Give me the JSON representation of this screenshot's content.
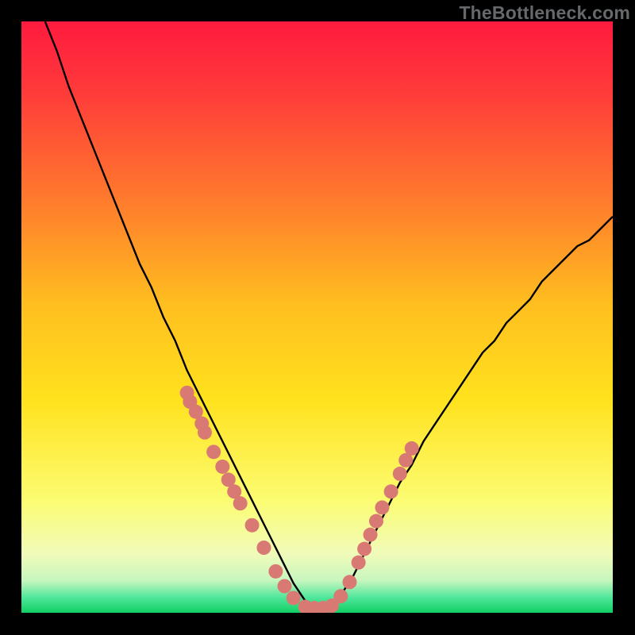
{
  "attribution": "TheBottleneck.com",
  "colors": {
    "black": "#000000",
    "curve": "#000000",
    "marker": "#d97973",
    "gradient_top": "#ff1a3f",
    "gradient_mid_upper": "#ff7a2d",
    "gradient_mid": "#ffd21e",
    "gradient_mid_lower": "#fff79a",
    "gradient_bottom": "#13e06a"
  },
  "chart_data": {
    "type": "line",
    "title": "",
    "xlabel": "",
    "ylabel": "",
    "x": [
      0.04,
      0.06,
      0.08,
      0.1,
      0.12,
      0.14,
      0.16,
      0.18,
      0.2,
      0.22,
      0.24,
      0.26,
      0.28,
      0.3,
      0.32,
      0.34,
      0.36,
      0.38,
      0.4,
      0.42,
      0.44,
      0.46,
      0.48,
      0.5,
      0.52,
      0.54,
      0.56,
      0.58,
      0.6,
      0.62,
      0.64,
      0.66,
      0.68,
      0.7,
      0.72,
      0.74,
      0.76,
      0.78,
      0.8,
      0.82,
      0.84,
      0.86,
      0.88,
      0.9,
      0.92,
      0.94,
      0.96,
      0.98,
      1.0
    ],
    "values": [
      1.0,
      0.95,
      0.89,
      0.84,
      0.79,
      0.74,
      0.69,
      0.64,
      0.59,
      0.55,
      0.5,
      0.46,
      0.41,
      0.37,
      0.33,
      0.29,
      0.25,
      0.21,
      0.17,
      0.13,
      0.09,
      0.05,
      0.02,
      0.01,
      0.01,
      0.03,
      0.06,
      0.1,
      0.14,
      0.18,
      0.22,
      0.25,
      0.29,
      0.32,
      0.35,
      0.38,
      0.41,
      0.44,
      0.46,
      0.49,
      0.51,
      0.53,
      0.56,
      0.58,
      0.6,
      0.62,
      0.63,
      0.65,
      0.67
    ],
    "xlim": [
      0,
      1
    ],
    "ylim": [
      0,
      1
    ],
    "marker_points_x": [
      0.28,
      0.285,
      0.295,
      0.305,
      0.31,
      0.325,
      0.34,
      0.35,
      0.36,
      0.37,
      0.39,
      0.41,
      0.43,
      0.445,
      0.46,
      0.48,
      0.495,
      0.51,
      0.525,
      0.54,
      0.555,
      0.57,
      0.58,
      0.59,
      0.6,
      0.61,
      0.625,
      0.64,
      0.65,
      0.66
    ],
    "marker_points_y": [
      0.372,
      0.357,
      0.34,
      0.32,
      0.305,
      0.272,
      0.247,
      0.225,
      0.205,
      0.185,
      0.148,
      0.11,
      0.07,
      0.045,
      0.025,
      0.01,
      0.008,
      0.008,
      0.012,
      0.028,
      0.052,
      0.085,
      0.108,
      0.132,
      0.155,
      0.178,
      0.205,
      0.235,
      0.258,
      0.278
    ],
    "gradient_stops": [
      {
        "offset": 0.0,
        "color": "#ff1a3f"
      },
      {
        "offset": 0.12,
        "color": "#ff3b3a"
      },
      {
        "offset": 0.3,
        "color": "#ff7a2d"
      },
      {
        "offset": 0.48,
        "color": "#ffbf1f"
      },
      {
        "offset": 0.64,
        "color": "#ffe21e"
      },
      {
        "offset": 0.81,
        "color": "#fcfc72"
      },
      {
        "offset": 0.9,
        "color": "#f1fbb9"
      },
      {
        "offset": 0.945,
        "color": "#c8f6bf"
      },
      {
        "offset": 0.975,
        "color": "#4de69a"
      },
      {
        "offset": 1.0,
        "color": "#11cf62"
      }
    ]
  }
}
